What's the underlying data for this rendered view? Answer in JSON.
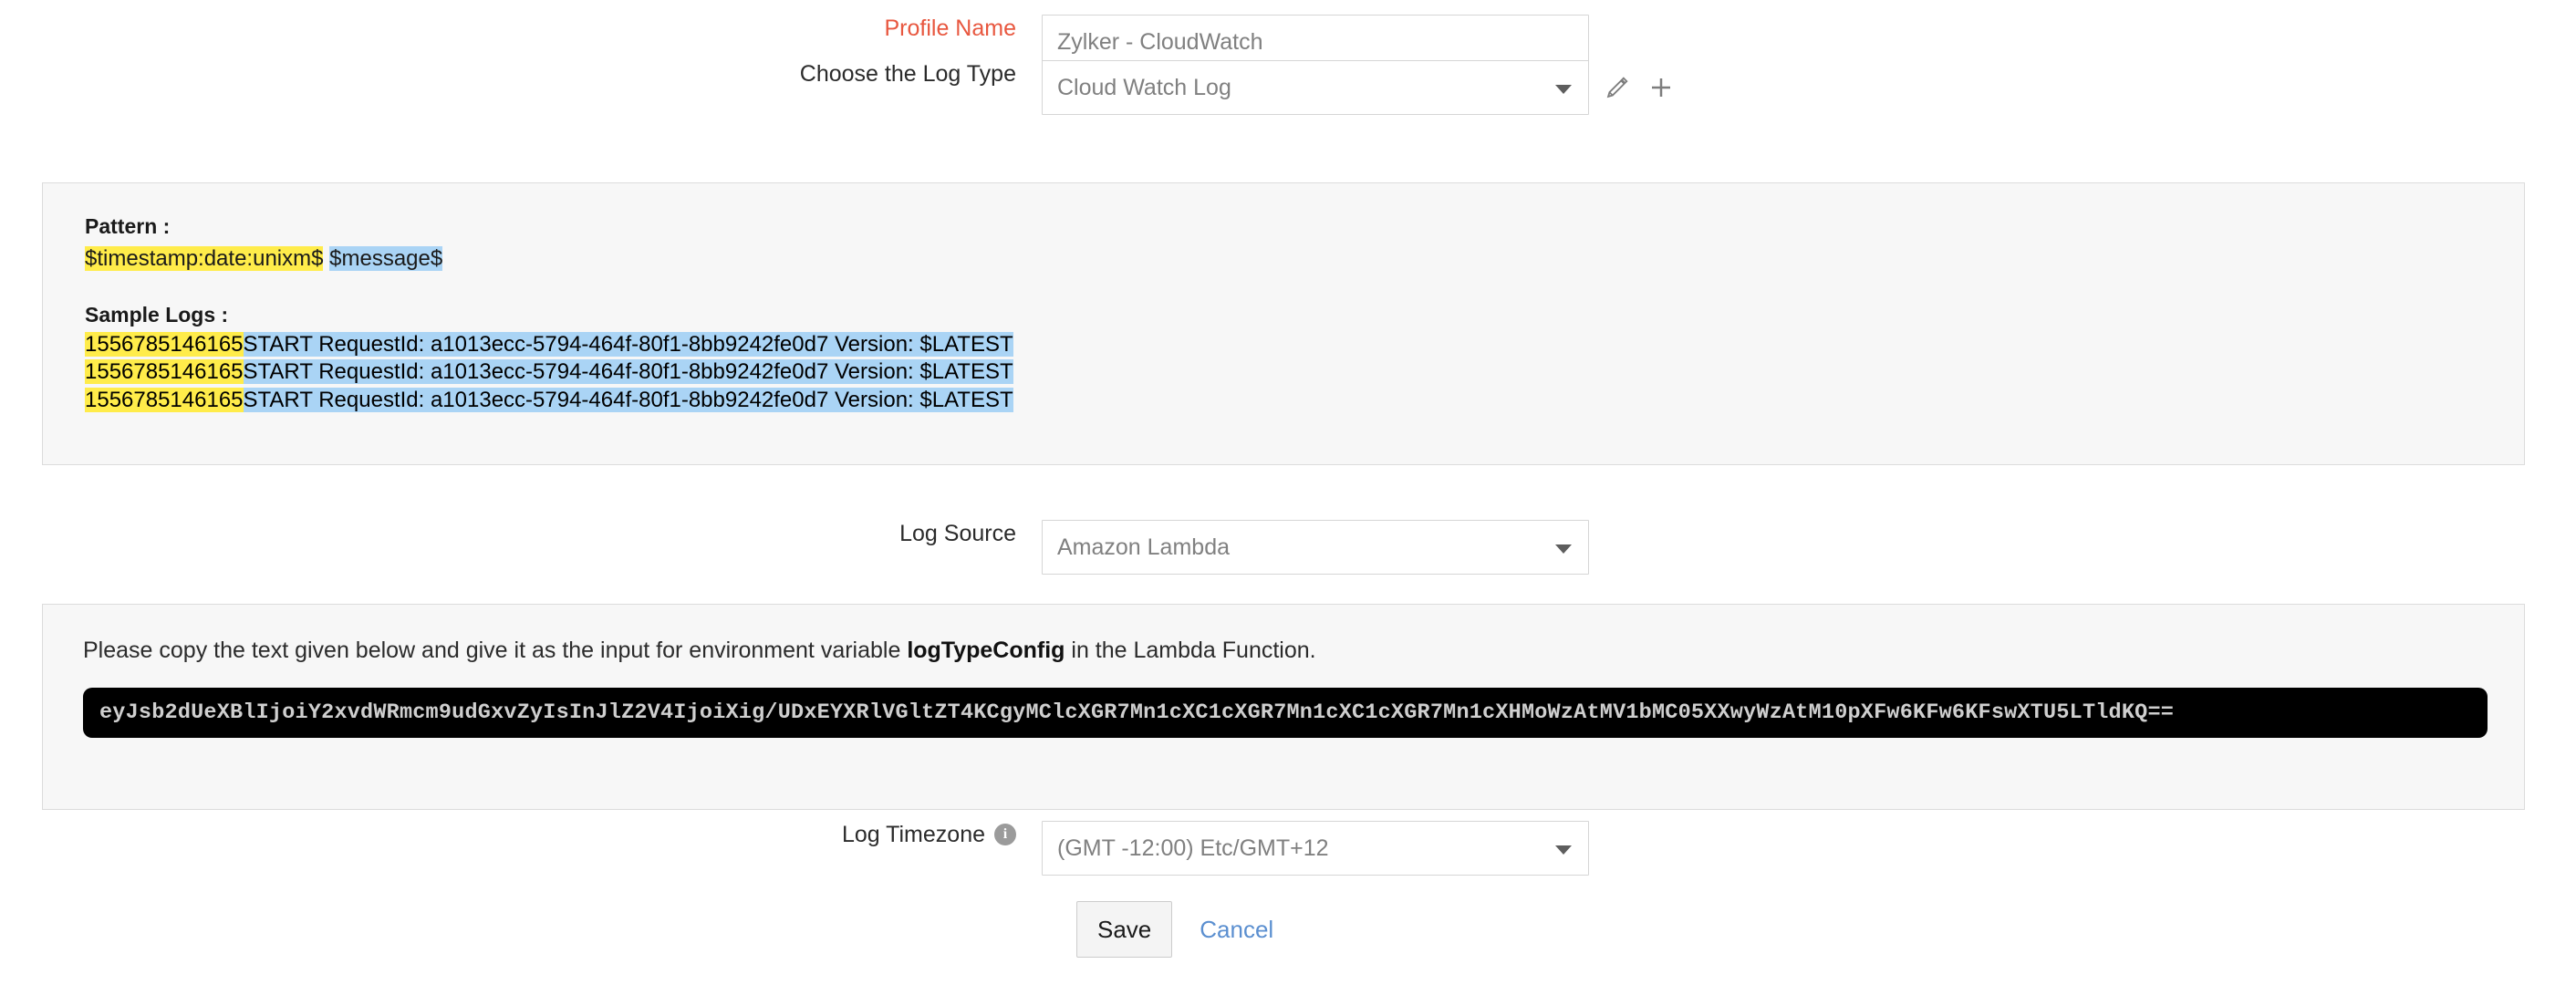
{
  "form": {
    "profile_name": {
      "label": "Profile Name",
      "value": "Zylker - CloudWatch",
      "required": true
    },
    "log_type": {
      "label": "Choose the Log Type",
      "value": "Cloud Watch Log",
      "edit_icon": "pencil-icon",
      "add_icon": "plus-icon"
    },
    "log_source": {
      "label": "Log Source",
      "value": "Amazon Lambda"
    },
    "log_timezone": {
      "label": "Log Timezone",
      "value": "(GMT -12:00) Etc/GMT+12",
      "info_icon": "info-icon",
      "info_glyph": "i"
    }
  },
  "pattern_panel": {
    "pattern_title": "Pattern :",
    "pattern_tokens": [
      {
        "text": "$timestamp:date:unixm$",
        "highlight": "yellow"
      },
      {
        "text": " ",
        "highlight": "none"
      },
      {
        "text": "$message$",
        "highlight": "blue"
      }
    ],
    "samples_title": "Sample Logs :",
    "sample_logs": [
      {
        "timestamp": "1556785146165",
        "message": "START RequestId: a1013ecc-5794-464f-80f1-8bb9242fe0d7 Version: $LATEST"
      },
      {
        "timestamp": "1556785146165",
        "message": "START RequestId: a1013ecc-5794-464f-80f1-8bb9242fe0d7 Version: $LATEST"
      },
      {
        "timestamp": "1556785146165",
        "message": "START RequestId: a1013ecc-5794-464f-80f1-8bb9242fe0d7 Version: $LATEST"
      }
    ]
  },
  "config_panel": {
    "note_prefix": "Please copy the text given below and give it as the input for environment variable ",
    "note_variable": "logTypeConfig",
    "note_suffix": " in the Lambda Function.",
    "config_string": "eyJsb2dUeXBlIjoiY2xvdWRmcm9udGxvZyIsInJlZ2V4IjoiXig/UDxEYXRlVGltZT4KCgyMClcXGR7Mn1cXC1cXGR7Mn1cXC1cXGR7Mn1cXHMoWzAtMV1bMC05XXwyWzAtM10pXFw6KFw6KFswXTU5LTldKQ=="
  },
  "actions": {
    "save_label": "Save",
    "cancel_label": "Cancel"
  },
  "colors": {
    "required_label": "#e8573f",
    "highlight_yellow": "#ffec4a",
    "highlight_blue": "#aad4f5",
    "panel_bg": "#f7f7f7",
    "code_bg": "#000000",
    "link_blue": "#5b8fd0"
  }
}
